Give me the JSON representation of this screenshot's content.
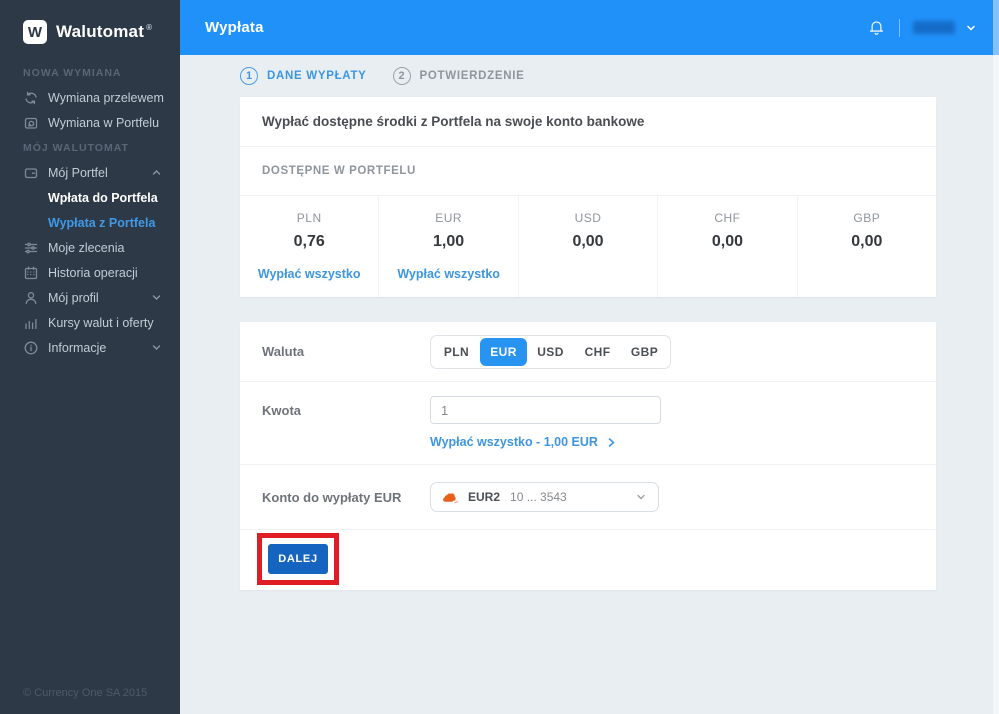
{
  "brand": {
    "logo_letter": "W",
    "name": "Walutomat",
    "registered": "®"
  },
  "topbar": {
    "title": "Wypłata"
  },
  "sidebar": {
    "section1": "NOWA WYMIANA",
    "section2": "MÓJ WALUTOMAT",
    "items": [
      {
        "label": "Wymiana przelewem",
        "icon": "exchange-icon"
      },
      {
        "label": "Wymiana w Portfelu",
        "icon": "wallet-exchange-icon"
      },
      {
        "label": "Mój Portfel",
        "icon": "wallet-icon"
      },
      {
        "label": "Wpłata do Portfela"
      },
      {
        "label": "Wypłata z Portfela"
      },
      {
        "label": "Moje zlecenia",
        "icon": "orders-icon"
      },
      {
        "label": "Historia operacji",
        "icon": "history-icon"
      },
      {
        "label": "Mój profil",
        "icon": "profile-icon"
      },
      {
        "label": "Kursy walut i oferty",
        "icon": "rates-icon"
      },
      {
        "label": "Informacje",
        "icon": "info-icon"
      }
    ],
    "footer": "© Currency One SA 2015"
  },
  "steps": {
    "step1_num": "1",
    "step1_label": "DANE WYPŁATY",
    "step2_num": "2",
    "step2_label": "POTWIERDZENIE"
  },
  "wallet_panel": {
    "intro": "Wypłać dostępne środki z Portfela na swoje konto bankowe",
    "section_title": "DOSTĘPNE W PORTFELU",
    "balances": [
      {
        "currency": "PLN",
        "amount": "0,76",
        "action": "Wypłać wszystko"
      },
      {
        "currency": "EUR",
        "amount": "1,00",
        "action": "Wypłać wszystko"
      },
      {
        "currency": "USD",
        "amount": "0,00",
        "action": ""
      },
      {
        "currency": "CHF",
        "amount": "0,00",
        "action": ""
      },
      {
        "currency": "GBP",
        "amount": "0,00",
        "action": ""
      }
    ]
  },
  "form": {
    "currency_label": "Waluta",
    "currencies": [
      "PLN",
      "EUR",
      "USD",
      "CHF",
      "GBP"
    ],
    "selected_currency": "EUR",
    "amount_label": "Kwota",
    "amount_value": "1",
    "withdraw_all_link": "Wypłać wszystko - 1,00 EUR",
    "account_label": "Konto do wypłaty EUR",
    "account_name": "EUR2",
    "account_number": "10 ... 3543",
    "submit_label": "DALEJ"
  },
  "colors": {
    "header_blue": "#2191fa",
    "accent_blue": "#3d96e0",
    "selected_toggle_blue": "#2794f2",
    "active_nav_blue": "#3d9ae8",
    "submit_blue": "#1565c0",
    "highlight_red": "#e01c24",
    "sidebar_bg": "#2e3947",
    "page_bg": "#e9eef3",
    "bank_icon_orange": "#e8611c"
  }
}
